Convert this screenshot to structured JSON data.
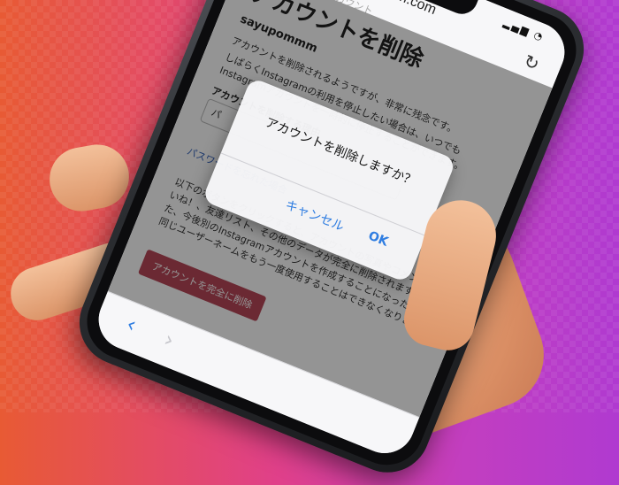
{
  "browser": {
    "url": "instagram.com",
    "status_icons": "▂▄▆ ◔",
    "back_icon": "‹",
    "forward_icon": "›",
    "reload_icon": "↻"
  },
  "page": {
    "breadcrumb": "…のアカウント",
    "title": "アカウントを削除",
    "username": "sayupommm",
    "para1": "アカウントを削除されるようですが、非常に残念です。",
    "para2": "しばらくInstagramの利用を停止したい場合は、いつでもInstagramアカウントを一時的に停止することができます。",
    "reason_label": "アカウントを削除する理由",
    "select_value": "パ",
    "password_link": "パスワードを忘れた場合",
    "para3": "以下のボタンをクリックすると、アカウントの写真やコメント、いいね！、友達リスト、その他のデータが完全に削除されます。また、今後別のInstagramアカウントを作成することになった場合、同じユーザーネームをもう一度使用することはできなくなります。",
    "delete_button": "アカウントを完全に削除"
  },
  "dialog": {
    "message": "アカウントを削除しますか？",
    "cancel": "キャンセル",
    "ok": "OK"
  },
  "colors": {
    "link": "#2f7de1",
    "delete_button": "#b84858"
  }
}
